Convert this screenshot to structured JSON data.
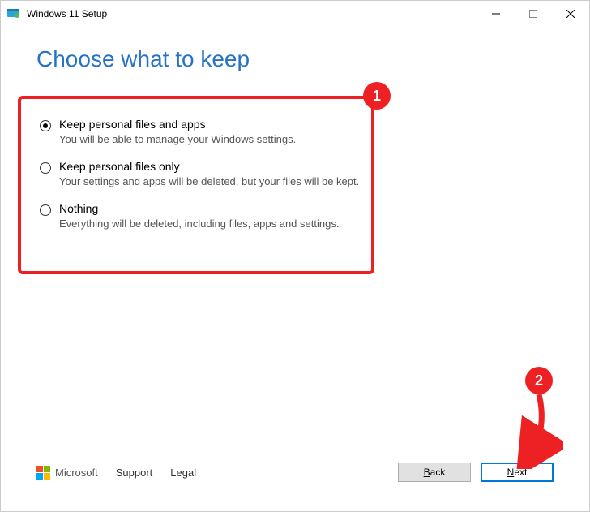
{
  "window": {
    "title": "Windows 11 Setup"
  },
  "heading": "Choose what to keep",
  "options": [
    {
      "label": "Keep personal files and apps",
      "description": "You will be able to manage your Windows settings.",
      "checked": true
    },
    {
      "label": "Keep personal files only",
      "description": "Your settings and apps will be deleted, but your files will be kept.",
      "checked": false
    },
    {
      "label": "Nothing",
      "description": "Everything will be deleted, including files, apps and settings.",
      "checked": false
    }
  ],
  "footer": {
    "brand": "Microsoft",
    "links": [
      "Support",
      "Legal"
    ],
    "back_label": "Back",
    "next_label": "Next"
  },
  "annotations": {
    "badge1": "1",
    "badge2": "2"
  }
}
